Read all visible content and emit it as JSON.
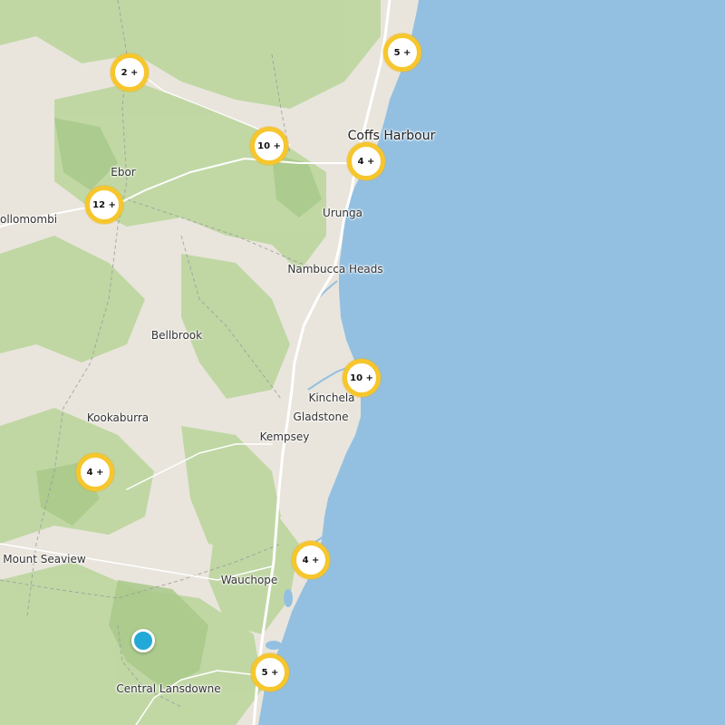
{
  "map": {
    "colors": {
      "sea": "#93c0e1",
      "land": "#e9e5dc",
      "forest": "#b9d39b",
      "road": "#ffffff",
      "cluster_ring": "#f6c62c",
      "marker": "#23a9d8"
    },
    "places": [
      {
        "name": "Coffs Harbour",
        "kind": "city"
      },
      {
        "name": "Ebor",
        "kind": "town"
      },
      {
        "name": "ollomombi",
        "kind": "town"
      },
      {
        "name": "Urunga",
        "kind": "town"
      },
      {
        "name": "Nambucca Heads",
        "kind": "town"
      },
      {
        "name": "Bellbrook",
        "kind": "town"
      },
      {
        "name": "Kinchela",
        "kind": "town"
      },
      {
        "name": "Gladstone",
        "kind": "town"
      },
      {
        "name": "Kempsey",
        "kind": "town"
      },
      {
        "name": "Kookaburra",
        "kind": "town"
      },
      {
        "name": "Mount Seaview",
        "kind": "town"
      },
      {
        "name": "Wauchope",
        "kind": "town"
      },
      {
        "name": "Central Lansdowne",
        "kind": "town"
      }
    ],
    "clusters": [
      "5 +",
      "2 +",
      "10 +",
      "4 +",
      "12 +",
      "10 +",
      "4 +",
      "4 +",
      "5 +"
    ]
  }
}
